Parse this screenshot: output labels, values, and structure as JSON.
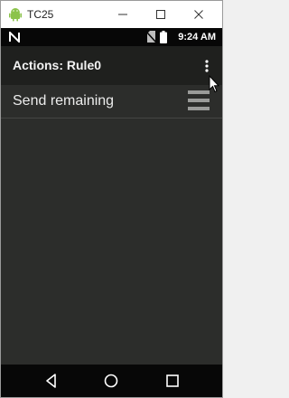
{
  "window": {
    "title": "TC25",
    "icons": {
      "app": "android-icon",
      "minimize": "minimize-icon",
      "maximize": "maximize-icon",
      "close": "close-icon"
    }
  },
  "status_bar": {
    "time": "9:24 AM",
    "icons": [
      "n-notification-icon",
      "no-sim-icon",
      "battery-icon"
    ]
  },
  "app_bar": {
    "title": "Actions: Rule0",
    "menu_icon": "more-vert-icon"
  },
  "list": {
    "items": [
      {
        "label": "Send remaining",
        "icon": "drag-handle-icon"
      }
    ]
  },
  "nav_bar": {
    "icons": [
      "back-icon",
      "home-icon",
      "recents-icon"
    ]
  },
  "colors": {
    "background": "#2c2d2b",
    "app_bar": "#1f201e",
    "status_bar": "#070707",
    "text": "#ececec"
  }
}
